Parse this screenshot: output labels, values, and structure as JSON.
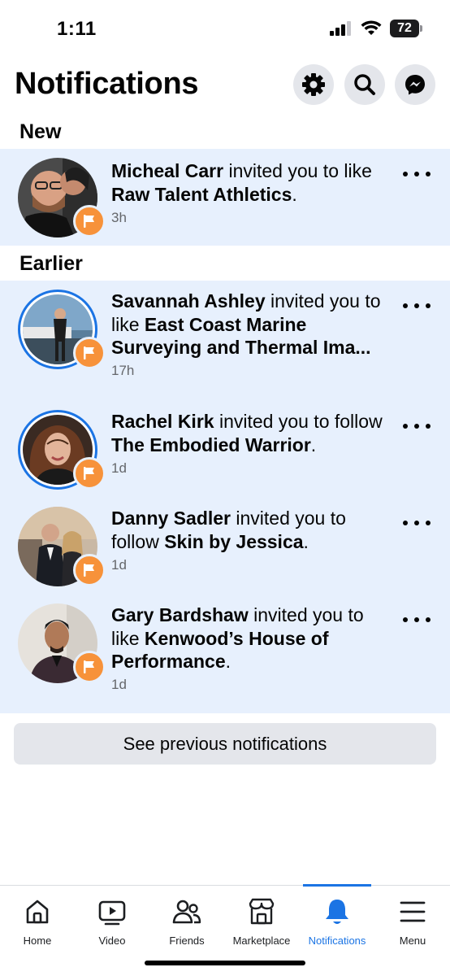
{
  "status_bar": {
    "time": "1:11",
    "battery": "72"
  },
  "header": {
    "title": "Notifications"
  },
  "sections": {
    "new": "New",
    "earlier": "Earlier"
  },
  "notifications": [
    {
      "name": "Micheal Carr",
      "action": " invited you to like ",
      "target": "Raw Talent Athletics",
      "suffix": ".",
      "time": "3h"
    },
    {
      "name": "Savannah Ashley",
      "action": " invited you to like ",
      "target": "East Coast Marine Surveying and Thermal Ima...",
      "suffix": "",
      "time": "17h"
    },
    {
      "name": "Rachel Kirk",
      "action": " invited you to follow ",
      "target": "The Embodied Warrior",
      "suffix": ".",
      "time": "1d"
    },
    {
      "name": "Danny Sadler",
      "action": " invited you to follow ",
      "target": "Skin by Jessica",
      "suffix": ".",
      "time": "1d"
    },
    {
      "name": "Gary Bardshaw",
      "action": " invited you to like ",
      "target": "Kenwood’s House of Performance",
      "suffix": ".",
      "time": "1d"
    }
  ],
  "see_previous": "See previous notifications",
  "nav": [
    {
      "label": "Home"
    },
    {
      "label": "Video"
    },
    {
      "label": "Friends"
    },
    {
      "label": "Marketplace"
    },
    {
      "label": "Notifications"
    },
    {
      "label": "Menu"
    }
  ],
  "colors": {
    "accent": "#1b74e4",
    "unread_bg": "#e7f0fd",
    "badge": "#f7923a",
    "secondary_text": "#65676b"
  },
  "icons": {
    "header": [
      "gear-icon",
      "search-icon",
      "messenger-icon"
    ],
    "badge": "flag-icon",
    "nav": [
      "home-icon",
      "video-icon",
      "friends-icon",
      "marketplace-icon",
      "bell-icon",
      "menu-icon"
    ]
  }
}
